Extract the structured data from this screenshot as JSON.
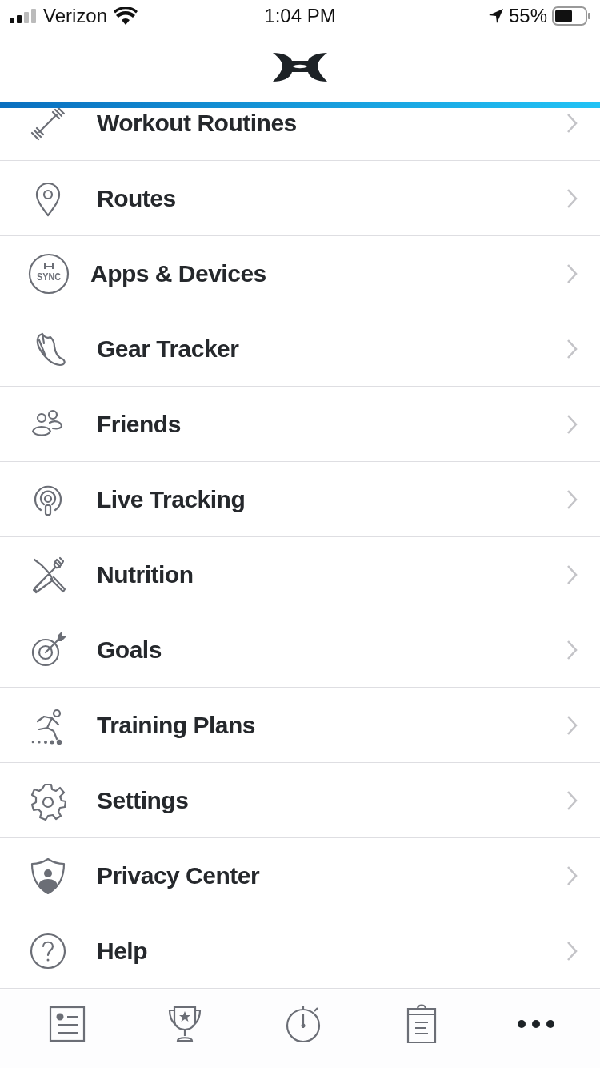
{
  "status_bar": {
    "carrier": "Verizon",
    "time": "1:04 PM",
    "battery": "55%"
  },
  "menu": [
    {
      "label": "Workout Routines",
      "kind": "dumbbell"
    },
    {
      "label": "Routes",
      "kind": "pin"
    },
    {
      "label": "Apps & Devices",
      "kind": "sync",
      "icon_text": "SYNC"
    },
    {
      "label": "Gear Tracker",
      "kind": "shoe"
    },
    {
      "label": "Friends",
      "kind": "people"
    },
    {
      "label": "Live Tracking",
      "kind": "broadcast"
    },
    {
      "label": "Nutrition",
      "kind": "cutlery"
    },
    {
      "label": "Goals",
      "kind": "target"
    },
    {
      "label": "Training Plans",
      "kind": "runner"
    },
    {
      "label": "Settings",
      "kind": "gear"
    },
    {
      "label": "Privacy Center",
      "kind": "shield"
    },
    {
      "label": "Help",
      "kind": "help"
    }
  ],
  "tab_bar": [
    {
      "kind": "feed",
      "selected": false
    },
    {
      "kind": "trophy",
      "selected": false
    },
    {
      "kind": "stopwatch",
      "selected": false
    },
    {
      "kind": "clipboard",
      "selected": false
    },
    {
      "kind": "more",
      "selected": true
    }
  ]
}
